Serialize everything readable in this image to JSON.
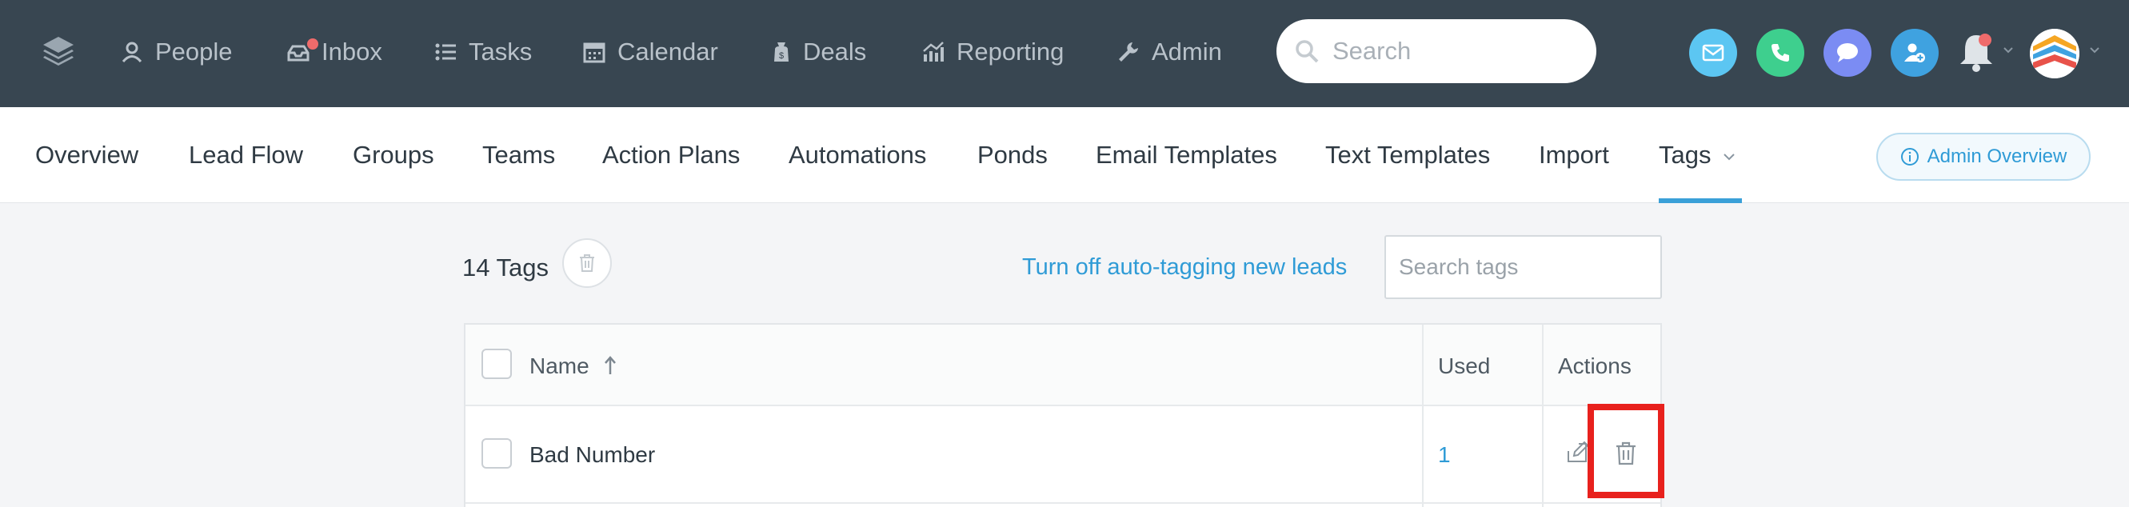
{
  "topnav": {
    "items": [
      {
        "label": "People",
        "icon": "person-icon"
      },
      {
        "label": "Inbox",
        "icon": "inbox-icon"
      },
      {
        "label": "Tasks",
        "icon": "tasks-list-icon"
      },
      {
        "label": "Calendar",
        "icon": "calendar-icon"
      },
      {
        "label": "Deals",
        "icon": "deals-bag-icon"
      },
      {
        "label": "Reporting",
        "icon": "reporting-chart-icon"
      },
      {
        "label": "Admin",
        "icon": "wrench-icon"
      }
    ],
    "search_placeholder": "Search",
    "quick_actions": [
      "email-icon",
      "phone-icon",
      "chat-icon",
      "add-contact-icon"
    ],
    "colors": {
      "bar": "#384651",
      "email": "#5cc6f2",
      "phone": "#3ecf8e",
      "chat": "#7b8cf3",
      "add_contact": "#3fa2e0",
      "notification_dot": "#ef6b6b"
    }
  },
  "subnav": {
    "tabs": [
      {
        "label": "Overview"
      },
      {
        "label": "Lead Flow"
      },
      {
        "label": "Groups"
      },
      {
        "label": "Teams"
      },
      {
        "label": "Action Plans"
      },
      {
        "label": "Automations"
      },
      {
        "label": "Ponds"
      },
      {
        "label": "Email Templates"
      },
      {
        "label": "Text Templates"
      },
      {
        "label": "Import"
      },
      {
        "label": "Tags",
        "active": true
      }
    ],
    "admin_overview_label": "Admin Overview"
  },
  "tags": {
    "count_label": "14 Tags",
    "autotag_link": "Turn off auto-tagging new leads",
    "search_placeholder": "Search tags",
    "columns": {
      "name": "Name",
      "used": "Used",
      "actions": "Actions"
    },
    "sort": "ascending",
    "rows": [
      {
        "name": "Bad Number",
        "used": "1"
      }
    ]
  }
}
